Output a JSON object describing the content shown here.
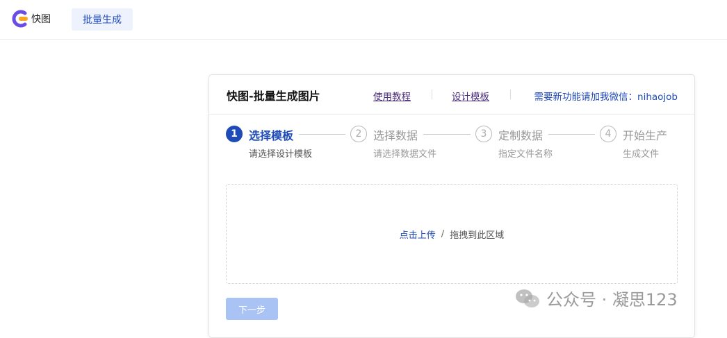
{
  "app": {
    "logo_text": "快图",
    "nav_tab": "批量生成"
  },
  "card": {
    "title": "快图-批量生成图片",
    "links": {
      "tutorial": "使用教程",
      "design_template": "设计模板"
    },
    "contact": "需要新功能请加我微信：nihaojob"
  },
  "steps": [
    {
      "number": "1",
      "title": "选择模板",
      "desc": "请选择设计模板",
      "state": "active"
    },
    {
      "number": "2",
      "title": "选择数据",
      "desc": "请选择数据文件",
      "state": "pending"
    },
    {
      "number": "3",
      "title": "定制数据",
      "desc": "指定文件名称",
      "state": "pending"
    },
    {
      "number": "4",
      "title": "开始生产",
      "desc": "生成文件",
      "state": "pending"
    }
  ],
  "dropzone": {
    "upload_label": "点击上传",
    "separator": "/",
    "drag_label": "拖拽到此区域"
  },
  "next_button": "下一步",
  "watermark": "公众号 · 凝思123",
  "colors": {
    "accent": "#1f4bb8",
    "accent_light": "#eef2fd",
    "button_disabled": "#a9c3f5",
    "logo_purple": "#6b4ce6",
    "logo_orange": "#f5a623"
  },
  "icons": {
    "logo": "kuaitu-logo-icon",
    "watermark": "wechat-icon"
  }
}
